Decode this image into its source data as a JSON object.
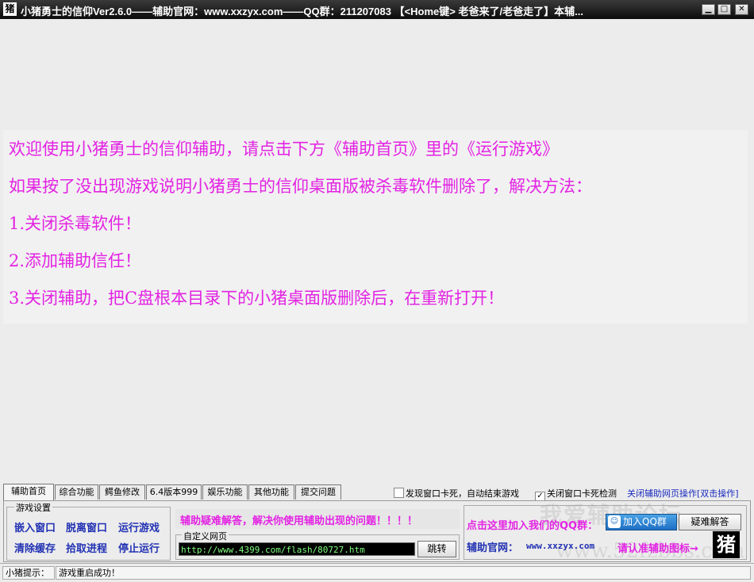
{
  "window": {
    "title": "小猪勇士的信仰Ver2.6.0——辅助官网：www.xxzyx.com——QQ群：211207083 【<Home键> 老爸来了/老爸走了】本辅...",
    "icon_glyph": "猪",
    "min_glyph": "▁",
    "max_glyph": "□",
    "close_glyph": "✕"
  },
  "messages": [
    "欢迎使用小猪勇士的信仰辅助，请点击下方《辅助首页》里的《运行游戏》",
    "如果按了没出现游戏说明小猪勇士的信仰桌面版被杀毒软件删除了，解决方法：",
    "1.关闭杀毒软件！",
    "2.添加辅助信任！",
    "3.关闭辅助，把C盘根本目录下的小猪桌面版删除后，在重新打开！"
  ],
  "tabs": [
    "辅助首页",
    "综合功能",
    "鳄鱼修改",
    "6.4版本999",
    "娱乐功能",
    "其他功能",
    "提交问题"
  ],
  "options": {
    "detect_freeze": {
      "label": "发现窗口卡死，自动结束游戏",
      "checked": false
    },
    "close_freeze_check": {
      "label": "关闭窗口卡死检测",
      "checked": true
    },
    "close_web_ops": "关闭辅助网页操作[双击操作]"
  },
  "game_settings": {
    "title": "游戏设置",
    "embed_window": "嵌入窗口",
    "detach_window": "脱离窗口",
    "run_game": "运行游戏",
    "clear_cache": "清除缓存",
    "pick_process": "拾取进程",
    "stop_running": "停止运行"
  },
  "help_banner": "辅助疑难解答，解决你使用辅助出现的问题！！！！",
  "custom_page": {
    "title": "自定义网页",
    "url": "http://www.4399.com/flash/80727.htm",
    "jump_label": "跳转"
  },
  "right_panel": {
    "qq_label": "点击这里加入我们的QQ群：",
    "qq_button": "加入QQ群",
    "faq_button": "疑难解答",
    "site_label": "官网：",
    "site_label_prefix": "辅助",
    "site_url": "www.xxzyx.com",
    "icon_hint": "请认准辅助图标→",
    "pig_glyph": "猪"
  },
  "watermark": {
    "line1": "我爱辅助论坛",
    "line2": "www.52fzbbs.com"
  },
  "status": {
    "label": "小猪提示：",
    "message": "游戏重启成功！"
  },
  "colors": {
    "pink": "#e323e3",
    "blue": "#2131b3",
    "titlebar": "#1e1e1e"
  }
}
